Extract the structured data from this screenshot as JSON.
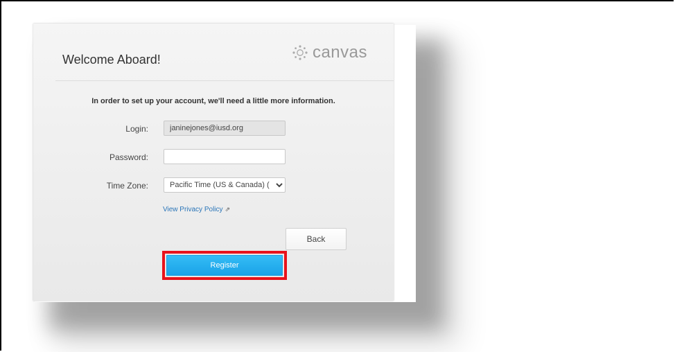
{
  "header": {
    "welcome_title": "Welcome Aboard!",
    "brand_name": "canvas"
  },
  "form": {
    "intro_text": "In order to set up your account, we'll need a little more information.",
    "login_label": "Login:",
    "login_value": "janinejones@iusd.org",
    "password_label": "Password:",
    "password_value": "",
    "timezone_label": "Time Zone:",
    "timezone_value": "Pacific Time (US & Canada) (",
    "privacy_link": "View Privacy Policy",
    "back_label": "Back",
    "register_label": "Register"
  },
  "colors": {
    "register_bg": "#1aa3e8",
    "highlight_border": "#e8121b",
    "link": "#2a75b8",
    "logo": "#999999"
  },
  "icons": {
    "logo": "canvas-logo-icon",
    "external": "external-link-icon",
    "dropdown": "chevron-down-icon"
  }
}
